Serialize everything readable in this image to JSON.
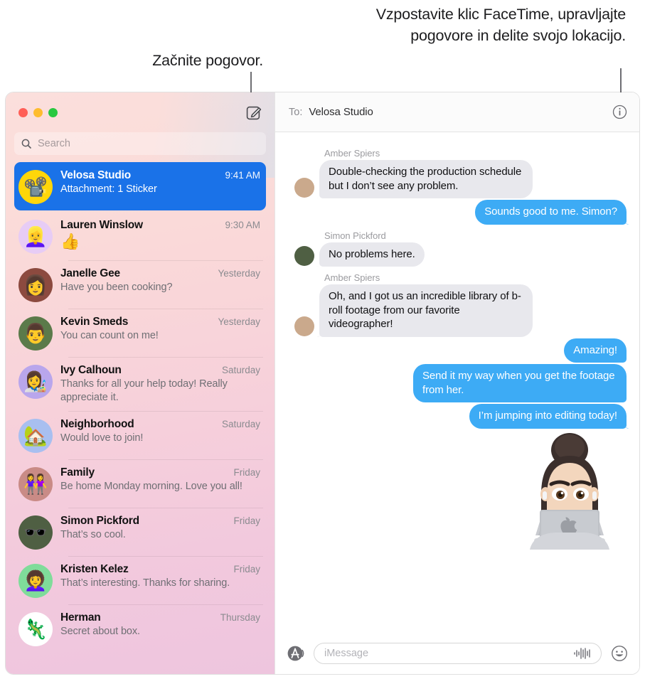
{
  "callouts": {
    "left": "Začnite pogovor.",
    "right": "Vzpostavite klic FaceTime, upravljajte pogovore in delite svojo lokacijo."
  },
  "window": {
    "traffic_lights": {
      "close": "close-button",
      "minimize": "minimize-button",
      "zoom": "zoom-button"
    },
    "compose_label": "compose-icon"
  },
  "sidebar": {
    "search": {
      "placeholder": "Search",
      "icon": "search-icon"
    },
    "conversations": [
      {
        "name": "Velosa Studio",
        "preview": "Attachment: 1 Sticker",
        "time": "9:41 AM",
        "selected": true,
        "avatar_glyph": "📽️",
        "avatar_bg": "#ffd60a"
      },
      {
        "name": "Lauren Winslow",
        "preview": "👍",
        "time": "9:30 AM",
        "selected": false,
        "avatar_glyph": "👱‍♀️",
        "avatar_bg": "#e7ccf5",
        "preview_is_emoji": true
      },
      {
        "name": "Janelle Gee",
        "preview": "Have you been cooking?",
        "time": "Yesterday",
        "selected": false,
        "avatar_glyph": "👩",
        "avatar_bg": "#8c4a3f"
      },
      {
        "name": "Kevin Smeds",
        "preview": "You can count on me!",
        "time": "Yesterday",
        "selected": false,
        "avatar_glyph": "👨",
        "avatar_bg": "#5b7a4a"
      },
      {
        "name": "Ivy Calhoun",
        "preview": "Thanks for all your help today! Really appreciate it.",
        "time": "Saturday",
        "selected": false,
        "avatar_glyph": "👩‍🎨",
        "avatar_bg": "#b9a6ec"
      },
      {
        "name": "Neighborhood",
        "preview": "Would love to join!",
        "time": "Saturday",
        "selected": false,
        "avatar_glyph": "🏡",
        "avatar_bg": "#a8bff0"
      },
      {
        "name": "Family",
        "preview": "Be home Monday morning. Love you all!",
        "time": "Friday",
        "selected": false,
        "avatar_glyph": "👭",
        "avatar_bg": "#c98b86"
      },
      {
        "name": "Simon Pickford",
        "preview": "That’s so cool.",
        "time": "Friday",
        "selected": false,
        "avatar_glyph": "🕶️",
        "avatar_bg": "#4f5f43"
      },
      {
        "name": "Kristen Kelez",
        "preview": "That’s interesting. Thanks for sharing.",
        "time": "Friday",
        "selected": false,
        "avatar_glyph": "👩‍🦱",
        "avatar_bg": "#7fdc9a"
      },
      {
        "name": "Herman",
        "preview": "Secret about box.",
        "time": "Thursday",
        "selected": false,
        "avatar_glyph": "🦎",
        "avatar_bg": "#ffffff"
      }
    ]
  },
  "conversation": {
    "to_label": "To:",
    "to_value": "Velosa Studio",
    "info_icon": "info-icon",
    "messages": [
      {
        "sender": "Amber Spiers",
        "direction": "in",
        "text": "Double-checking the production schedule but I don’t see any problem.",
        "avatar_bg": "#caa98c"
      },
      {
        "sender": "",
        "direction": "out",
        "text": "Sounds good to me. Simon?",
        "tail": true
      },
      {
        "sender": "Simon Pickford",
        "direction": "in",
        "text": "No problems here.",
        "avatar_bg": "#4f5f43"
      },
      {
        "sender": "Amber Spiers",
        "direction": "in",
        "text": "Oh, and I got us an incredible library of b-roll footage from our favorite videographer!",
        "avatar_bg": "#caa98c"
      },
      {
        "sender": "",
        "direction": "out",
        "text": "Amazing!",
        "tail": false
      },
      {
        "sender": "",
        "direction": "out",
        "text": "Send it my way when you get the footage from her.",
        "tail": false
      },
      {
        "sender": "",
        "direction": "out",
        "text": "I’m jumping into editing today!",
        "tail": true
      }
    ],
    "sticker": {
      "name": "memoji-laptop-sticker"
    }
  },
  "composer": {
    "apps_icon": "apps-store-icon",
    "placeholder": "iMessage",
    "value": "",
    "audio_icon": "audio-waveform-icon",
    "emoji_icon": "emoji-smiley-icon"
  },
  "colors": {
    "accent_blue": "#1a72e8",
    "bubble_out": "#3dabf5",
    "bubble_in": "#e8e8ed",
    "sidebar_top": "#fbdfdc",
    "sidebar_bottom": "#eec5de"
  }
}
